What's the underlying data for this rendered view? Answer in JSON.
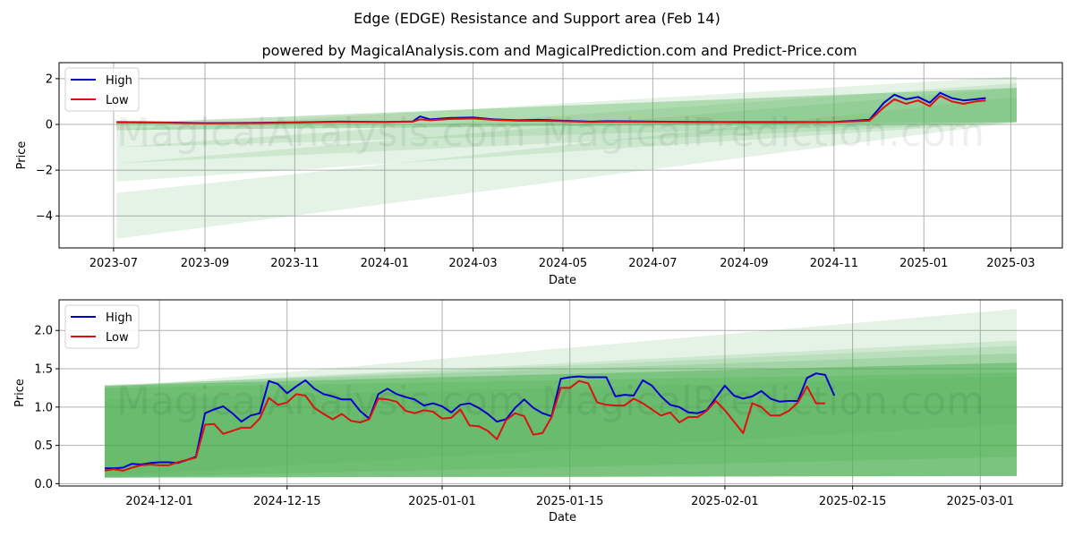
{
  "title": "Edge (EDGE) Resistance and Support area (Feb 14)",
  "subtitle": "powered by MagicalAnalysis.com and MagicalPrediction.com and Predict-Price.com",
  "watermarks": [
    "MagicalAnalysis.com",
    "MagicalPrediction.com"
  ],
  "colors": {
    "high": "#0000cc",
    "low": "#dd1111",
    "band": "#4caf50",
    "grid": "#b0b0b0"
  },
  "chart_data": [
    {
      "type": "line",
      "name": "full-history",
      "xlabel": "Date",
      "ylabel": "Price",
      "ylim": [
        -5.4,
        2.7
      ],
      "xlim": [
        "2023-05-25",
        "2025-04-05"
      ],
      "grid": true,
      "legend": "top-left",
      "yticks": [
        2,
        0,
        -2,
        -4
      ],
      "ytick_labels": [
        "2",
        "0",
        "−2",
        "−4"
      ],
      "xticks": [
        "2023-07-01",
        "2023-09-01",
        "2023-11-01",
        "2024-01-01",
        "2024-03-01",
        "2024-05-01",
        "2024-07-01",
        "2024-09-01",
        "2024-11-01",
        "2025-01-01",
        "2025-03-01"
      ],
      "xtick_labels": [
        "2023-07",
        "2023-09",
        "2023-11",
        "2024-01",
        "2024-03",
        "2024-05",
        "2024-07",
        "2024-09",
        "2024-11",
        "2025-01",
        "2025-03"
      ],
      "x": [
        "2023-07-03",
        "2023-08-01",
        "2023-09-01",
        "2023-10-01",
        "2023-11-01",
        "2023-12-01",
        "2024-01-01",
        "2024-01-20",
        "2024-01-25",
        "2024-02-01",
        "2024-02-15",
        "2024-03-01",
        "2024-03-15",
        "2024-04-01",
        "2024-04-15",
        "2024-05-01",
        "2024-05-20",
        "2024-06-01",
        "2024-07-01",
        "2024-08-01",
        "2024-09-01",
        "2024-10-01",
        "2024-11-01",
        "2024-11-25",
        "2024-12-05",
        "2024-12-12",
        "2024-12-20",
        "2024-12-28",
        "2025-01-05",
        "2025-01-12",
        "2025-01-20",
        "2025-01-28",
        "2025-02-05",
        "2025-02-12"
      ],
      "series": [
        {
          "name": "High",
          "values": [
            0.1,
            0.09,
            0.06,
            0.07,
            0.09,
            0.12,
            0.11,
            0.13,
            0.35,
            0.22,
            0.28,
            0.3,
            0.22,
            0.18,
            0.2,
            0.16,
            0.12,
            0.14,
            0.12,
            0.11,
            0.1,
            0.1,
            0.11,
            0.2,
            0.95,
            1.3,
            1.1,
            1.2,
            0.95,
            1.38,
            1.15,
            1.05,
            1.1,
            1.15
          ]
        },
        {
          "name": "Low",
          "values": [
            0.09,
            0.08,
            0.05,
            0.06,
            0.08,
            0.11,
            0.1,
            0.12,
            0.22,
            0.18,
            0.24,
            0.26,
            0.2,
            0.16,
            0.17,
            0.14,
            0.1,
            0.12,
            0.11,
            0.1,
            0.09,
            0.09,
            0.1,
            0.17,
            0.75,
            1.1,
            0.9,
            1.05,
            0.8,
            1.25,
            1.0,
            0.9,
            1.0,
            1.05
          ]
        }
      ],
      "bands": [
        {
          "x": [
            "2023-07-03",
            "2025-03-05"
          ],
          "lower": [
            -5.0,
            0.1
          ],
          "upper": [
            -3.0,
            1.2
          ],
          "opacity": 0.15
        },
        {
          "x": [
            "2023-07-03",
            "2025-03-05"
          ],
          "lower": [
            -2.5,
            0.1
          ],
          "upper": [
            -1.7,
            1.6
          ],
          "opacity": 0.15
        },
        {
          "x": [
            "2023-07-03",
            "2025-03-05"
          ],
          "lower": [
            -1.7,
            0.1
          ],
          "upper": [
            -1.0,
            1.8
          ],
          "opacity": 0.15
        },
        {
          "x": [
            "2023-07-03",
            "2025-03-05"
          ],
          "lower": [
            -1.0,
            0.1
          ],
          "upper": [
            -0.25,
            2.1
          ],
          "opacity": 0.15
        },
        {
          "x": [
            "2023-07-03",
            "2025-03-05"
          ],
          "lower": [
            -0.25,
            0.1
          ],
          "upper": [
            0.05,
            1.6
          ],
          "opacity": 0.35
        }
      ]
    },
    {
      "type": "line",
      "name": "recent-zoom",
      "xlabel": "Date",
      "ylabel": "Price",
      "ylim": [
        -0.03,
        2.4
      ],
      "xlim": [
        "2024-11-20",
        "2025-03-10"
      ],
      "grid": true,
      "legend": "top-left",
      "yticks": [
        0.0,
        0.5,
        1.0,
        1.5,
        2.0
      ],
      "ytick_labels": [
        "0.0",
        "0.5",
        "1.0",
        "1.5",
        "2.0"
      ],
      "xticks": [
        "2024-12-01",
        "2024-12-15",
        "2025-01-01",
        "2025-01-15",
        "2025-02-01",
        "2025-02-15",
        "2025-03-01"
      ],
      "xtick_labels": [
        "2024-12-01",
        "2024-12-15",
        "2025-01-01",
        "2025-01-15",
        "2025-02-01",
        "2025-02-15",
        "2025-03-01"
      ],
      "start_date": "2024-11-25",
      "series": [
        {
          "name": "High",
          "values": [
            0.2,
            0.2,
            0.21,
            0.26,
            0.25,
            0.27,
            0.28,
            0.28,
            0.27,
            0.31,
            0.35,
            0.92,
            0.97,
            1.01,
            0.92,
            0.81,
            0.89,
            0.92,
            1.34,
            1.3,
            1.18,
            1.27,
            1.35,
            1.24,
            1.17,
            1.14,
            1.1,
            1.1,
            0.95,
            0.85,
            1.17,
            1.24,
            1.17,
            1.13,
            1.1,
            1.02,
            1.05,
            1.01,
            0.93,
            1.03,
            1.05,
            0.99,
            0.91,
            0.81,
            0.84,
            0.99,
            1.1,
            0.99,
            0.92,
            0.88,
            1.37,
            1.39,
            1.4,
            1.39,
            1.39,
            1.39,
            1.14,
            1.16,
            1.15,
            1.35,
            1.28,
            1.14,
            1.03,
            1.0,
            0.93,
            0.92,
            0.96,
            1.12,
            1.28,
            1.15,
            1.11,
            1.14,
            1.21,
            1.11,
            1.07,
            1.08,
            1.08,
            1.38,
            1.44,
            1.42,
            1.15
          ]
        },
        {
          "name": "Low",
          "values": [
            0.17,
            0.19,
            0.17,
            0.21,
            0.24,
            0.25,
            0.24,
            0.24,
            0.28,
            0.31,
            0.34,
            0.77,
            0.78,
            0.65,
            0.69,
            0.73,
            0.73,
            0.85,
            1.12,
            1.03,
            1.06,
            1.17,
            1.15,
            0.99,
            0.91,
            0.84,
            0.91,
            0.82,
            0.8,
            0.84,
            1.11,
            1.1,
            1.07,
            0.95,
            0.92,
            0.96,
            0.94,
            0.85,
            0.86,
            0.97,
            0.76,
            0.75,
            0.69,
            0.58,
            0.83,
            0.92,
            0.88,
            0.64,
            0.66,
            0.87,
            1.25,
            1.25,
            1.34,
            1.31,
            1.06,
            1.03,
            1.02,
            1.02,
            1.11,
            1.05,
            0.97,
            0.89,
            0.93,
            0.8,
            0.87,
            0.87,
            0.95,
            1.08,
            0.96,
            0.81,
            0.66,
            1.05,
            1.0,
            0.89,
            0.89,
            0.95,
            1.06,
            1.27,
            1.05,
            1.05
          ]
        }
      ],
      "bands": [
        {
          "x": [
            "2024-11-25",
            "2025-03-05"
          ],
          "lower": [
            0.08,
            0.1
          ],
          "upper": [
            1.25,
            2.28
          ],
          "opacity": 0.15
        },
        {
          "x": [
            "2024-11-25",
            "2025-03-05"
          ],
          "lower": [
            0.08,
            0.1
          ],
          "upper": [
            1.27,
            1.87
          ],
          "opacity": 0.15
        },
        {
          "x": [
            "2024-11-25",
            "2025-03-05"
          ],
          "lower": [
            0.08,
            0.1
          ],
          "upper": [
            1.28,
            1.8
          ],
          "opacity": 0.15
        },
        {
          "x": [
            "2024-11-25",
            "2025-03-05"
          ],
          "lower": [
            0.08,
            0.1
          ],
          "upper": [
            1.29,
            1.7
          ],
          "opacity": 0.2
        },
        {
          "x": [
            "2024-11-25",
            "2025-03-05"
          ],
          "lower": [
            0.08,
            0.1
          ],
          "upper": [
            1.28,
            1.58
          ],
          "opacity": 0.45
        },
        {
          "x": [
            "2024-11-25",
            "2025-03-05"
          ],
          "lower": [
            0.08,
            0.35
          ],
          "upper": [
            1.25,
            1.45
          ],
          "opacity": 0.25
        },
        {
          "x": [
            "2024-11-25",
            "2025-03-05"
          ],
          "lower": [
            0.1,
            0.78
          ],
          "upper": [
            1.1,
            1.4
          ],
          "opacity": 0.15
        }
      ]
    }
  ]
}
